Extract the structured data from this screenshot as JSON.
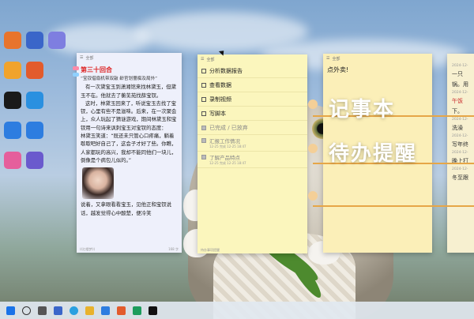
{
  "note_left": {
    "bar_label": "全部",
    "title": "第三十回合",
    "subtitle": "“宝钗借扇机带双敲 龄官划蔷痴及局外”",
    "paragraphs": [
      "有一次黛宝玉到潇湘馆来找林黛玉，但黛玉不在。他就去了蘅芜苑找薛宝钗。",
      "这时，林黛玉回来了，听说宝玉去找了宝钗，心里有些不是滋味。后来，在一次聚会上，众人玩起了猜谜游戏，期间林黛玉和宝钗用一句诗来讽刺宝玉对宝钗的态度：",
      "林黛玉笑道：“既还未只管心口疼痛，躺着歇歇吧好自己了，这会子才好了些。你瞧，人家都玩的高兴，我却不能同他们一块儿，倒像是个病包儿似的。”"
    ],
    "after_image": "说着，又拿眼看看宝玉，见他正和宝钗说话，越发觉得心中酸楚，便冷笑",
    "footer_left": "(《红楼梦》)",
    "footer_right": "168 字"
  },
  "note_todo": {
    "bar_label": "全部",
    "items": [
      {
        "label": "分析数据报告",
        "done": false
      },
      {
        "label": "查看数据",
        "done": false
      },
      {
        "label": "录制视频",
        "done": false
      },
      {
        "label": "写脚本",
        "done": false
      }
    ],
    "completed_header": "已完成 / 已放弃",
    "completed": [
      {
        "label": "汇报工作情况",
        "date": "12-25 完成 12-25 18:47"
      },
      {
        "label": "了解产品特点",
        "date": "12-25 完成 12-25 18:47"
      }
    ],
    "footer": "待办事项提醒"
  },
  "note_right": {
    "bar_label": "全部",
    "content": "点外卖!"
  },
  "note_far": {
    "lines": [
      {
        "text": "2024-12-",
        "style": "small"
      },
      {
        "text": "一只",
        "style": ""
      },
      {
        "text": "锅。用",
        "style": ""
      },
      {
        "text": "2024-12-",
        "style": "small"
      },
      {
        "text": "午饭",
        "style": "red"
      },
      {
        "text": "下。",
        "style": ""
      },
      {
        "text": "2024-12-",
        "style": "small"
      },
      {
        "text": "洗澡",
        "style": ""
      },
      {
        "text": "2024-12-",
        "style": "small"
      },
      {
        "text": "写年终",
        "style": ""
      },
      {
        "text": "2024-12-",
        "style": "small"
      },
      {
        "text": "晚上打",
        "style": ""
      },
      {
        "text": "2024-12-",
        "style": "small"
      },
      {
        "text": "冬至跟",
        "style": ""
      }
    ]
  },
  "overlay": {
    "label1": "记事本",
    "label2": "待办提醒"
  },
  "desktop_icons": [
    {
      "color": "#e8742c"
    },
    {
      "color": "#3a66c9"
    },
    {
      "color": "#7e7ee0"
    },
    {
      "color": "#f1a32c"
    },
    {
      "color": "#e25b2c"
    },
    {
      "color": "#d9692c"
    },
    {
      "color": "#1a1a1a"
    },
    {
      "color": "#2a90e0"
    },
    {
      "color": "#e8c21c"
    },
    {
      "color": "#2d7de0"
    },
    {
      "color": "#2d7de0"
    },
    {
      "color": "#28a745"
    },
    {
      "color": "#e55f9c"
    },
    {
      "color": "#6a5acd"
    },
    {
      "color": "#111111"
    }
  ]
}
